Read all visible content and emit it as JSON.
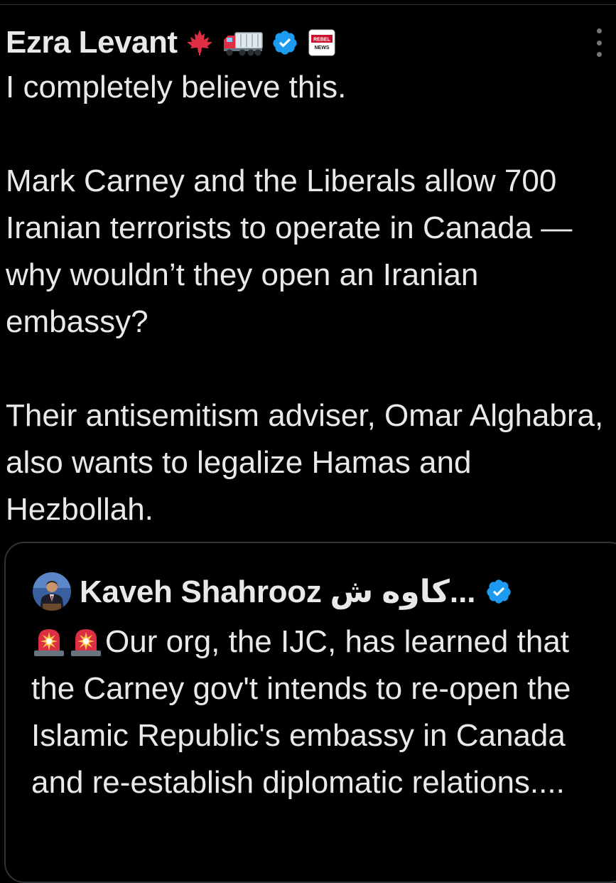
{
  "tweet": {
    "author_name": "Ezra Levant",
    "header_emojis": [
      "maple-leaf-icon",
      "truck-icon"
    ],
    "verified": true,
    "affiliate_badge": "REBEL NEWS",
    "text": "I completely believe this.\n\nMark Carney and the Liberals allow 700 Iranian terrorists to operate in Canada — why wouldn’t they open an Iranian embassy?\n\nTheir antisemitism adviser, Omar Alghabra, also wants to legalize Hamas and Hezbollah."
  },
  "quote": {
    "author_name": "Kaveh Shahrooz کاوه ش...",
    "verified": true,
    "leading_emojis": [
      "siren-icon",
      "siren-icon"
    ],
    "text": "Our org, the IJC, has learned that the Carney gov't intends to re-open the Islamic Republic's embassy in Canada and re-establish diplomatic relations...."
  },
  "colors": {
    "background": "#000000",
    "text": "#e7e9ea",
    "border": "#2f3336",
    "verified_blue": "#1d9bf0",
    "muted": "#71767b"
  }
}
